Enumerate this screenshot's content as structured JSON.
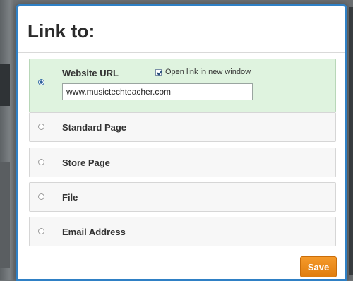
{
  "dialog": {
    "title": "Link to:",
    "accent_color": "#2f80c5"
  },
  "options": [
    {
      "label": "Website URL",
      "selected": true
    },
    {
      "label": "Standard Page",
      "selected": false
    },
    {
      "label": "Store Page",
      "selected": false
    },
    {
      "label": "File",
      "selected": false
    },
    {
      "label": "Email Address",
      "selected": false
    }
  ],
  "website": {
    "url_value": "www.musictechteacher.com",
    "open_new_window_label": "Open link in new window",
    "open_new_window_checked": true
  },
  "actions": {
    "save_label": "Save",
    "save_color": "#f0901f"
  },
  "colors": {
    "selected_row": "#dff3df"
  }
}
